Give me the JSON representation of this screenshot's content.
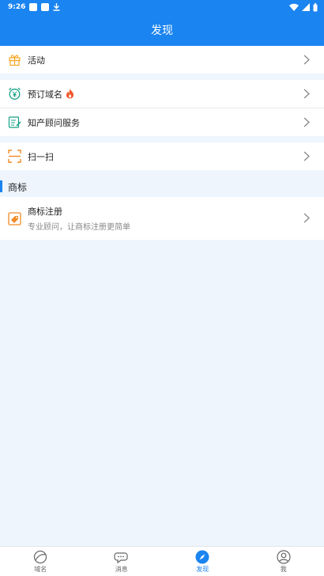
{
  "statusbar": {
    "time": "9:26"
  },
  "header": {
    "title": "发现"
  },
  "menu": {
    "activity": "活动",
    "reserve_domain": "预订域名",
    "ip_consult": "知产顾问服务",
    "scan": "扫一扫"
  },
  "trademark_section": {
    "title": "商标",
    "item_title": "商标注册",
    "item_subtitle": "专业顾问，让商标注册更简单"
  },
  "tabs": [
    {
      "label": "域名",
      "icon": "domain-icon"
    },
    {
      "label": "消息",
      "icon": "message-icon"
    },
    {
      "label": "发现",
      "icon": "compass-icon"
    },
    {
      "label": "我",
      "icon": "user-icon"
    }
  ],
  "colors": {
    "primary": "#1a84f0",
    "activity_icon": "#f5a623",
    "reserve_icon": "#16a085",
    "fire": "#f0582a",
    "trademark_icon": "#f28a25"
  }
}
